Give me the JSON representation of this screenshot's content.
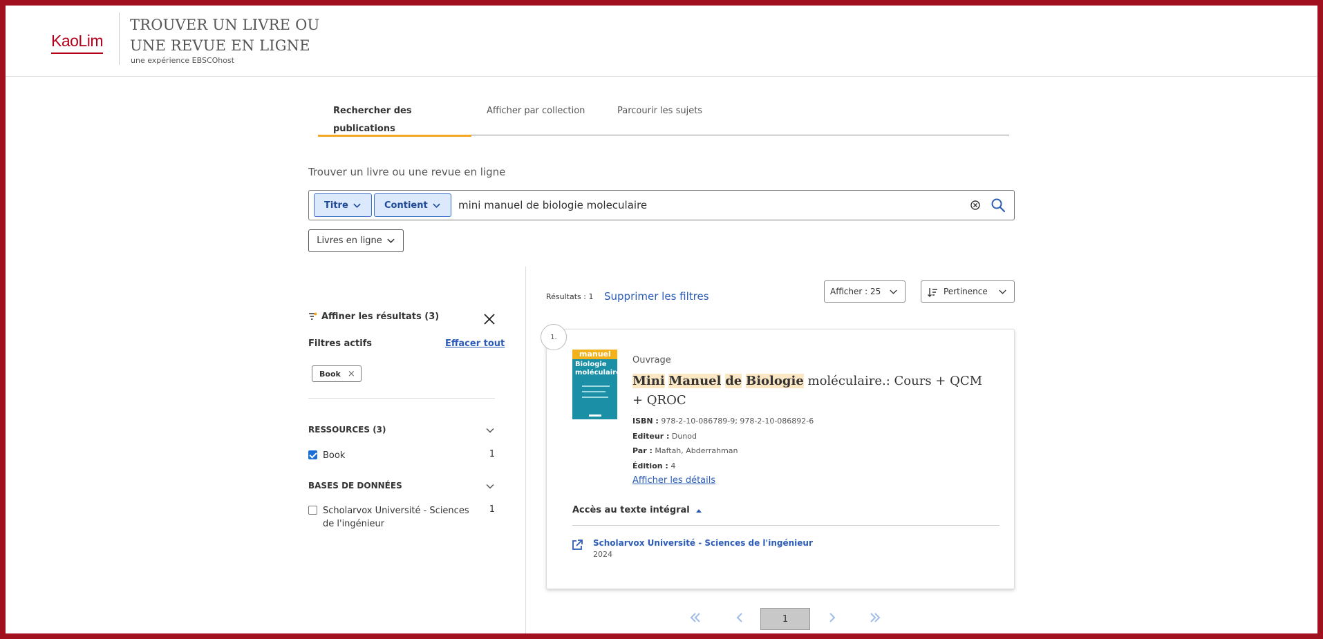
{
  "header": {
    "logo_text": "KaoLim",
    "title_line1": "TROUVER UN LIVRE OU",
    "title_line2": "UNE REVUE EN LIGNE",
    "subtitle": "une expérience EBSCOhost"
  },
  "tabs": [
    {
      "label": "Rechercher des publications",
      "active": true
    },
    {
      "label": "Afficher par collection",
      "active": false
    },
    {
      "label": "Parcourir les sujets",
      "active": false
    }
  ],
  "search": {
    "label": "Trouver un livre ou une revue en ligne",
    "field_select": "Titre",
    "operator_select": "Contient",
    "query": "mini manuel de biologie moleculaire",
    "type_filter": "Livres en ligne"
  },
  "filters": {
    "refine_title": "Affiner les résultats (3)",
    "active_label": "Filtres actifs",
    "clear_all": "Effacer tout",
    "active_chip": "Book",
    "chip_remove": "×",
    "facets": [
      {
        "heading": "RESSOURCES (3)",
        "items": [
          {
            "label": "Book",
            "count": "1",
            "checked": true
          }
        ]
      },
      {
        "heading": "BASES DE DONNÉES",
        "items": [
          {
            "label": "Scholarvox Université - Sciences de l'ingénieur",
            "count": "1",
            "checked": false
          }
        ]
      }
    ]
  },
  "results": {
    "count_text": "Résultats : 1",
    "remove_filters": "Supprimer les filtres",
    "per_page": "Afficher : 25",
    "sort": "Pertinence",
    "items": [
      {
        "number": "1.",
        "type": "Ouvrage",
        "cover_band": "manuel",
        "cover_title_1": "Biologie",
        "cover_title_2": "moléculaire",
        "title_hl": [
          "Mini",
          "Manuel",
          "de",
          "Biologie"
        ],
        "title_rest": "moléculaire.: Cours + QCM + QROC",
        "isbn_label": "ISBN :",
        "isbn": "978-2-10-086789-9; 978-2-10-086892-6",
        "publisher_label": "Editeur :",
        "publisher": "Dunod",
        "author_label": "Par :",
        "author": "Maftah, Abderrahman",
        "edition_label": "Édition :",
        "edition": "4",
        "details_link": "Afficher les détails",
        "fulltext_heading": "Accès au texte intégral",
        "fulltext_source": "Scholarvox Université - Sciences de l'ingénieur",
        "fulltext_year": "2024"
      }
    ]
  },
  "pagination": {
    "current": "1"
  },
  "colors": {
    "frame": "#a0101e",
    "accent": "#f5a623",
    "link": "#2b5cb8",
    "highlight": "#fbe7c3"
  }
}
